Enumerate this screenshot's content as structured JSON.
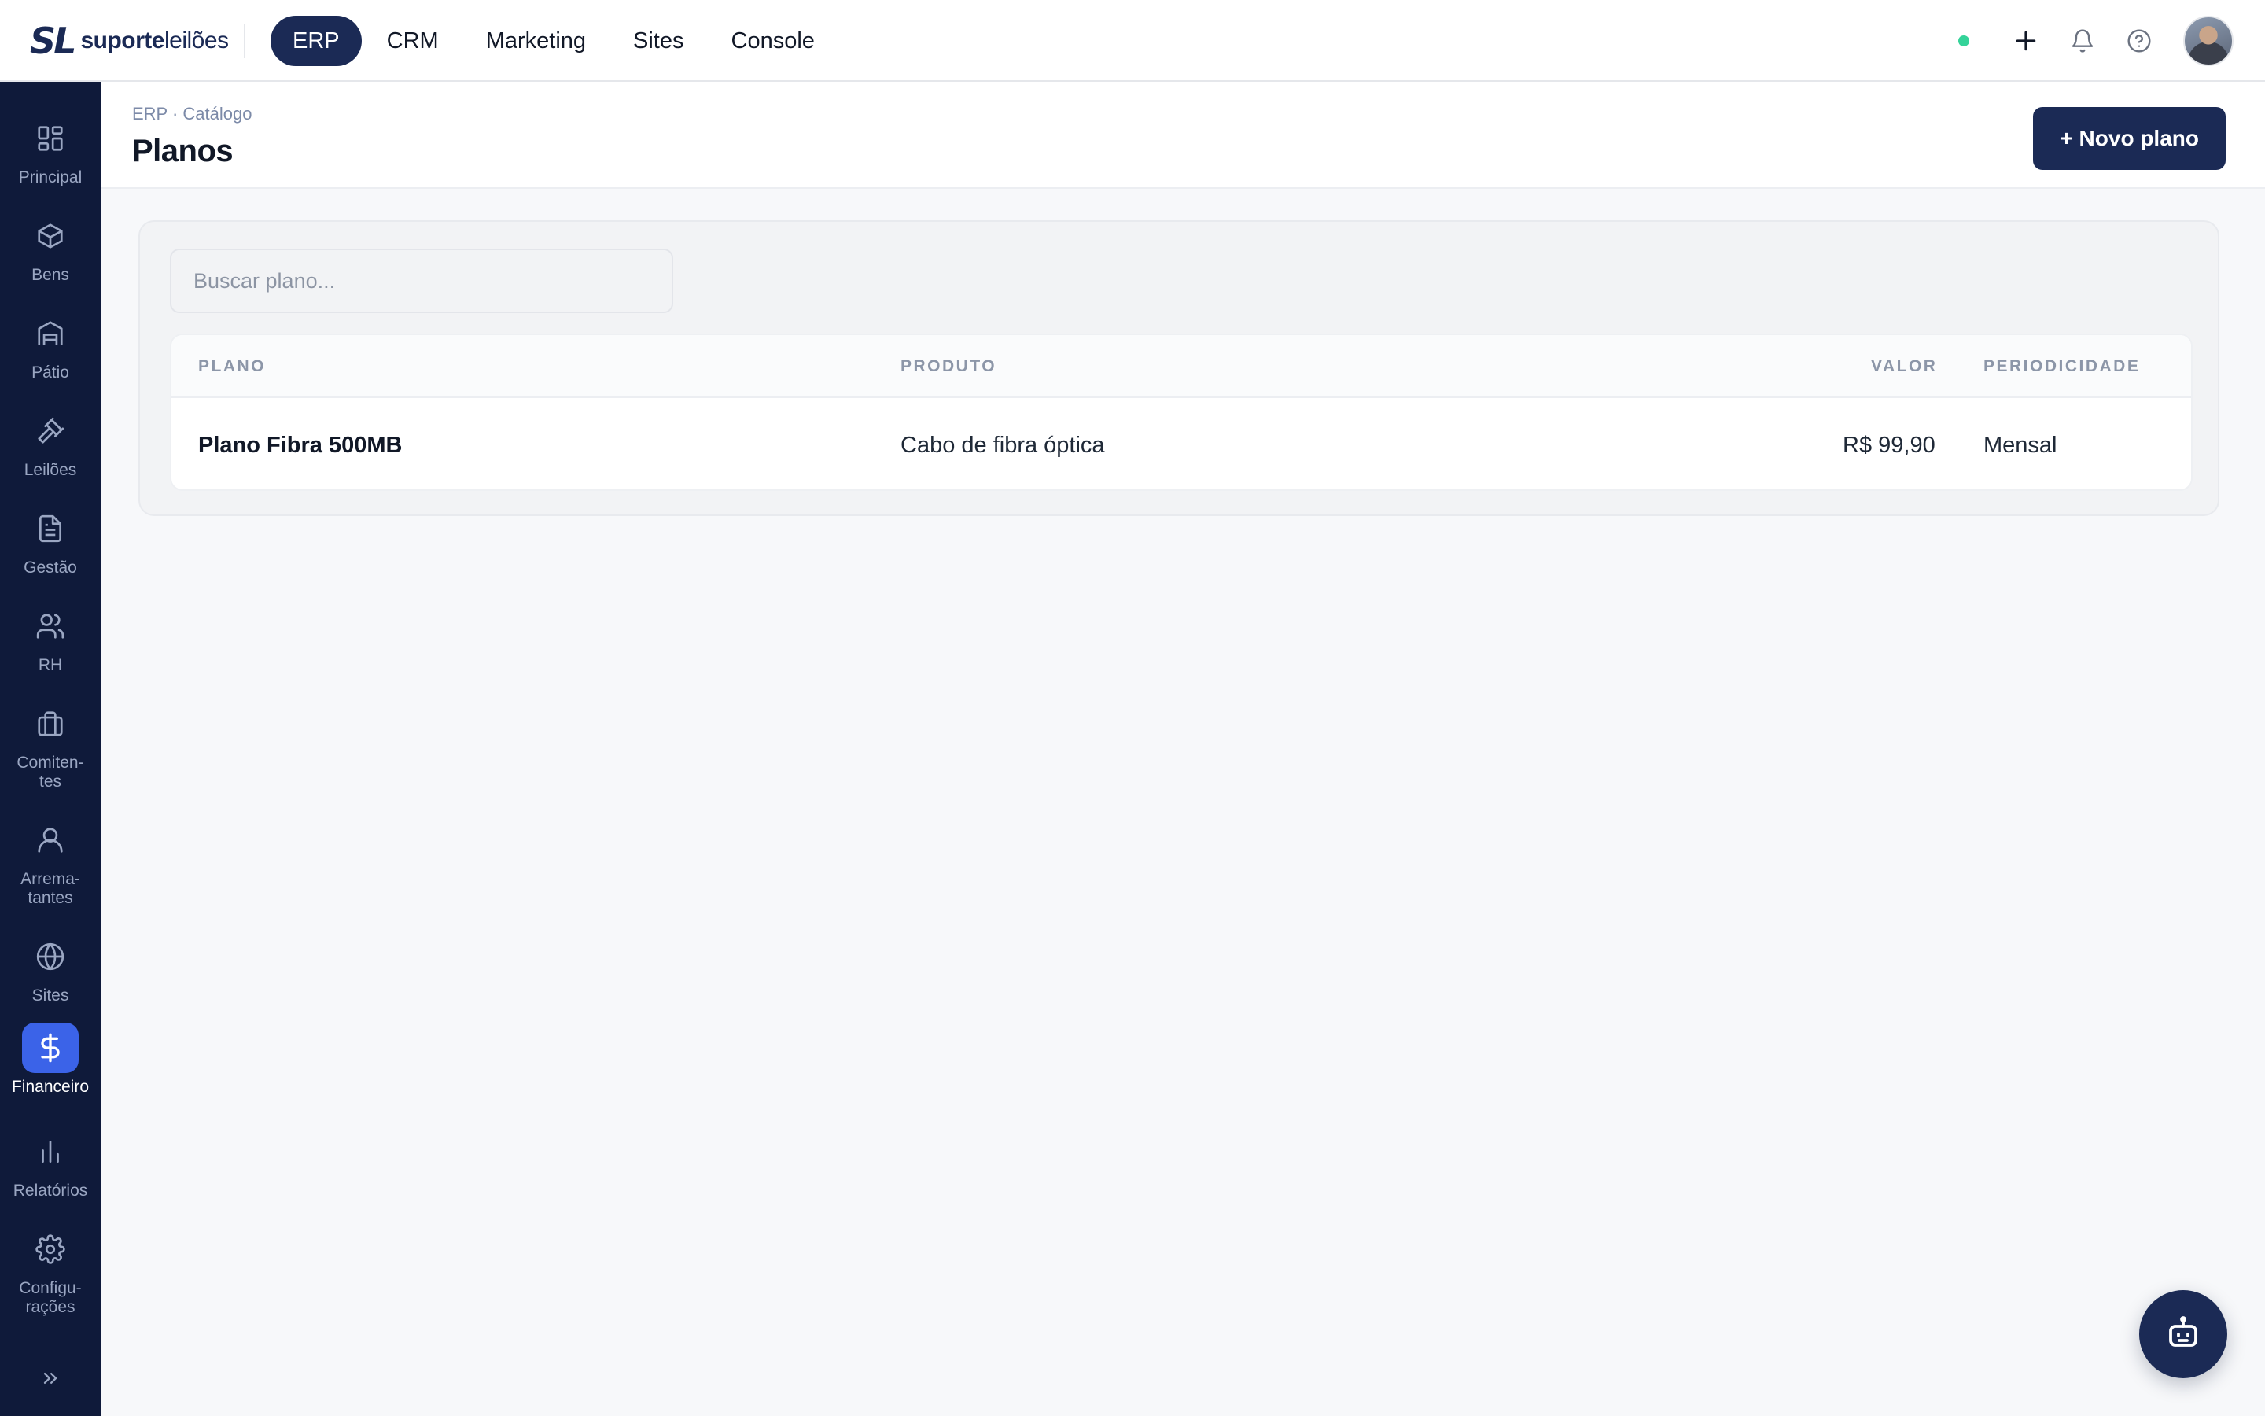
{
  "brand": {
    "mark": "SL",
    "name_bold": "suporte",
    "name_light": "leilões"
  },
  "topnav": [
    {
      "label": "ERP",
      "active": true
    },
    {
      "label": "CRM"
    },
    {
      "label": "Marketing"
    },
    {
      "label": "Sites"
    },
    {
      "label": "Console"
    }
  ],
  "top_actions": {
    "status_color": "#34d399",
    "icons": [
      "plus-icon",
      "bell-icon",
      "help-icon"
    ]
  },
  "sidebar": {
    "items": [
      {
        "label": "Principal",
        "icon": "dashboard-grid-icon"
      },
      {
        "label": "Bens",
        "icon": "box-icon"
      },
      {
        "label": "Pátio",
        "icon": "warehouse-icon"
      },
      {
        "label": "Leilões",
        "icon": "gavel-icon"
      },
      {
        "label": "Gestão",
        "icon": "document-icon"
      },
      {
        "label": "RH",
        "icon": "users-icon"
      },
      {
        "label": "Comiten-\ntes",
        "icon": "briefcase-icon"
      },
      {
        "label": "Arrema-\ntantes",
        "icon": "user-icon"
      },
      {
        "label": "Sites",
        "icon": "globe-icon"
      },
      {
        "label": "Financeiro",
        "icon": "dollar-icon",
        "active": true
      },
      {
        "label": "Relatórios",
        "icon": "bar-chart-icon"
      },
      {
        "label": "Configu-\nrações",
        "icon": "gear-icon"
      }
    ],
    "collapse_icon": "chevrons-right-icon"
  },
  "page": {
    "breadcrumb": "ERP · Catálogo",
    "title": "Planos",
    "new_button": "+ Novo plano"
  },
  "search": {
    "placeholder": "Buscar plano...",
    "value": ""
  },
  "table": {
    "headers": {
      "plano": "PLANO",
      "produto": "PRODUTO",
      "valor": "VALOR",
      "periodicidade": "PERIODICIDADE"
    },
    "rows": [
      {
        "plano": "Plano Fibra 500MB",
        "produto": "Cabo de fibra óptica",
        "valor": "R$ 99,90",
        "periodicidade": "Mensal",
        "edit_icon": "✎",
        "delete_icon": "×"
      }
    ]
  },
  "colors": {
    "navy": "#1b2a55",
    "sidebar": "#0f1a3a",
    "active_blue": "#3b63e8"
  }
}
